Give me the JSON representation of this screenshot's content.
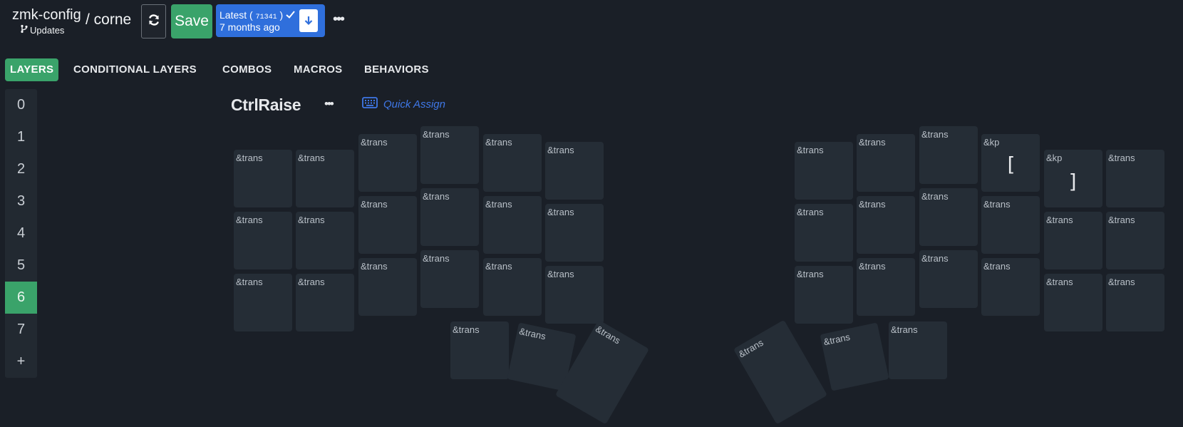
{
  "header": {
    "repo": "zmk-config",
    "branch": "Updates",
    "separator_keyboard": "/ corne",
    "save_label": "Save",
    "latest": {
      "label": "Latest (",
      "hash": "71341",
      "close": ")",
      "time": "7 months ago"
    },
    "more_label": "•••"
  },
  "tabs": [
    {
      "label": "LAYERS",
      "active": true
    },
    {
      "label": "CONDITIONAL LAYERS"
    },
    {
      "label": "COMBOS"
    },
    {
      "label": "MACROS"
    },
    {
      "label": "BEHAVIORS"
    }
  ],
  "layers": [
    "0",
    "1",
    "2",
    "3",
    "4",
    "5",
    "6",
    "7",
    "+"
  ],
  "active_layer": "6",
  "layer": {
    "title": "CtrlRaise",
    "more_label": "•••",
    "quick_assign": "Quick Assign"
  },
  "keys": [
    {
      "label": "&trans",
      "glyph": ""
    },
    {
      "label": "&trans",
      "glyph": ""
    },
    {
      "label": "&trans",
      "glyph": ""
    },
    {
      "label": "&trans",
      "glyph": ""
    },
    {
      "label": "&trans",
      "glyph": ""
    },
    {
      "label": "&trans",
      "glyph": ""
    },
    {
      "label": "&trans",
      "glyph": ""
    },
    {
      "label": "&trans",
      "glyph": ""
    },
    {
      "label": "&trans",
      "glyph": ""
    },
    {
      "label": "&kp",
      "glyph": "["
    },
    {
      "label": "&kp",
      "glyph": "]"
    },
    {
      "label": "&trans",
      "glyph": ""
    },
    {
      "label": "&trans",
      "glyph": ""
    },
    {
      "label": "&trans",
      "glyph": ""
    },
    {
      "label": "&trans",
      "glyph": ""
    },
    {
      "label": "&trans",
      "glyph": ""
    },
    {
      "label": "&trans",
      "glyph": ""
    },
    {
      "label": "&trans",
      "glyph": ""
    },
    {
      "label": "&trans",
      "glyph": ""
    },
    {
      "label": "&trans",
      "glyph": ""
    },
    {
      "label": "&trans",
      "glyph": ""
    },
    {
      "label": "&trans",
      "glyph": ""
    },
    {
      "label": "&trans",
      "glyph": ""
    },
    {
      "label": "&trans",
      "glyph": ""
    },
    {
      "label": "&trans",
      "glyph": ""
    },
    {
      "label": "&trans",
      "glyph": ""
    },
    {
      "label": "&trans",
      "glyph": ""
    },
    {
      "label": "&trans",
      "glyph": ""
    },
    {
      "label": "&trans",
      "glyph": ""
    },
    {
      "label": "&trans",
      "glyph": ""
    },
    {
      "label": "&trans",
      "glyph": ""
    },
    {
      "label": "&trans",
      "glyph": ""
    },
    {
      "label": "&trans",
      "glyph": ""
    },
    {
      "label": "&trans",
      "glyph": ""
    },
    {
      "label": "&trans",
      "glyph": ""
    },
    {
      "label": "&trans",
      "glyph": ""
    },
    {
      "label": "&trans",
      "glyph": ""
    },
    {
      "label": "&trans",
      "glyph": ""
    },
    {
      "label": "&trans",
      "glyph": ""
    },
    {
      "label": "&trans",
      "glyph": ""
    },
    {
      "label": "&trans",
      "glyph": ""
    },
    {
      "label": "&trans",
      "glyph": ""
    }
  ],
  "colors": {
    "background": "#1a1f27",
    "key": "#252d36",
    "accent_green": "#3aa36a",
    "accent_blue": "#2f6fdc",
    "link_blue": "#3f78e8"
  },
  "icons": {
    "sync": "sync-icon",
    "download": "file-download-icon",
    "check": "check-icon",
    "branch": "git-branch-icon",
    "keyboard": "keyboard-icon"
  }
}
